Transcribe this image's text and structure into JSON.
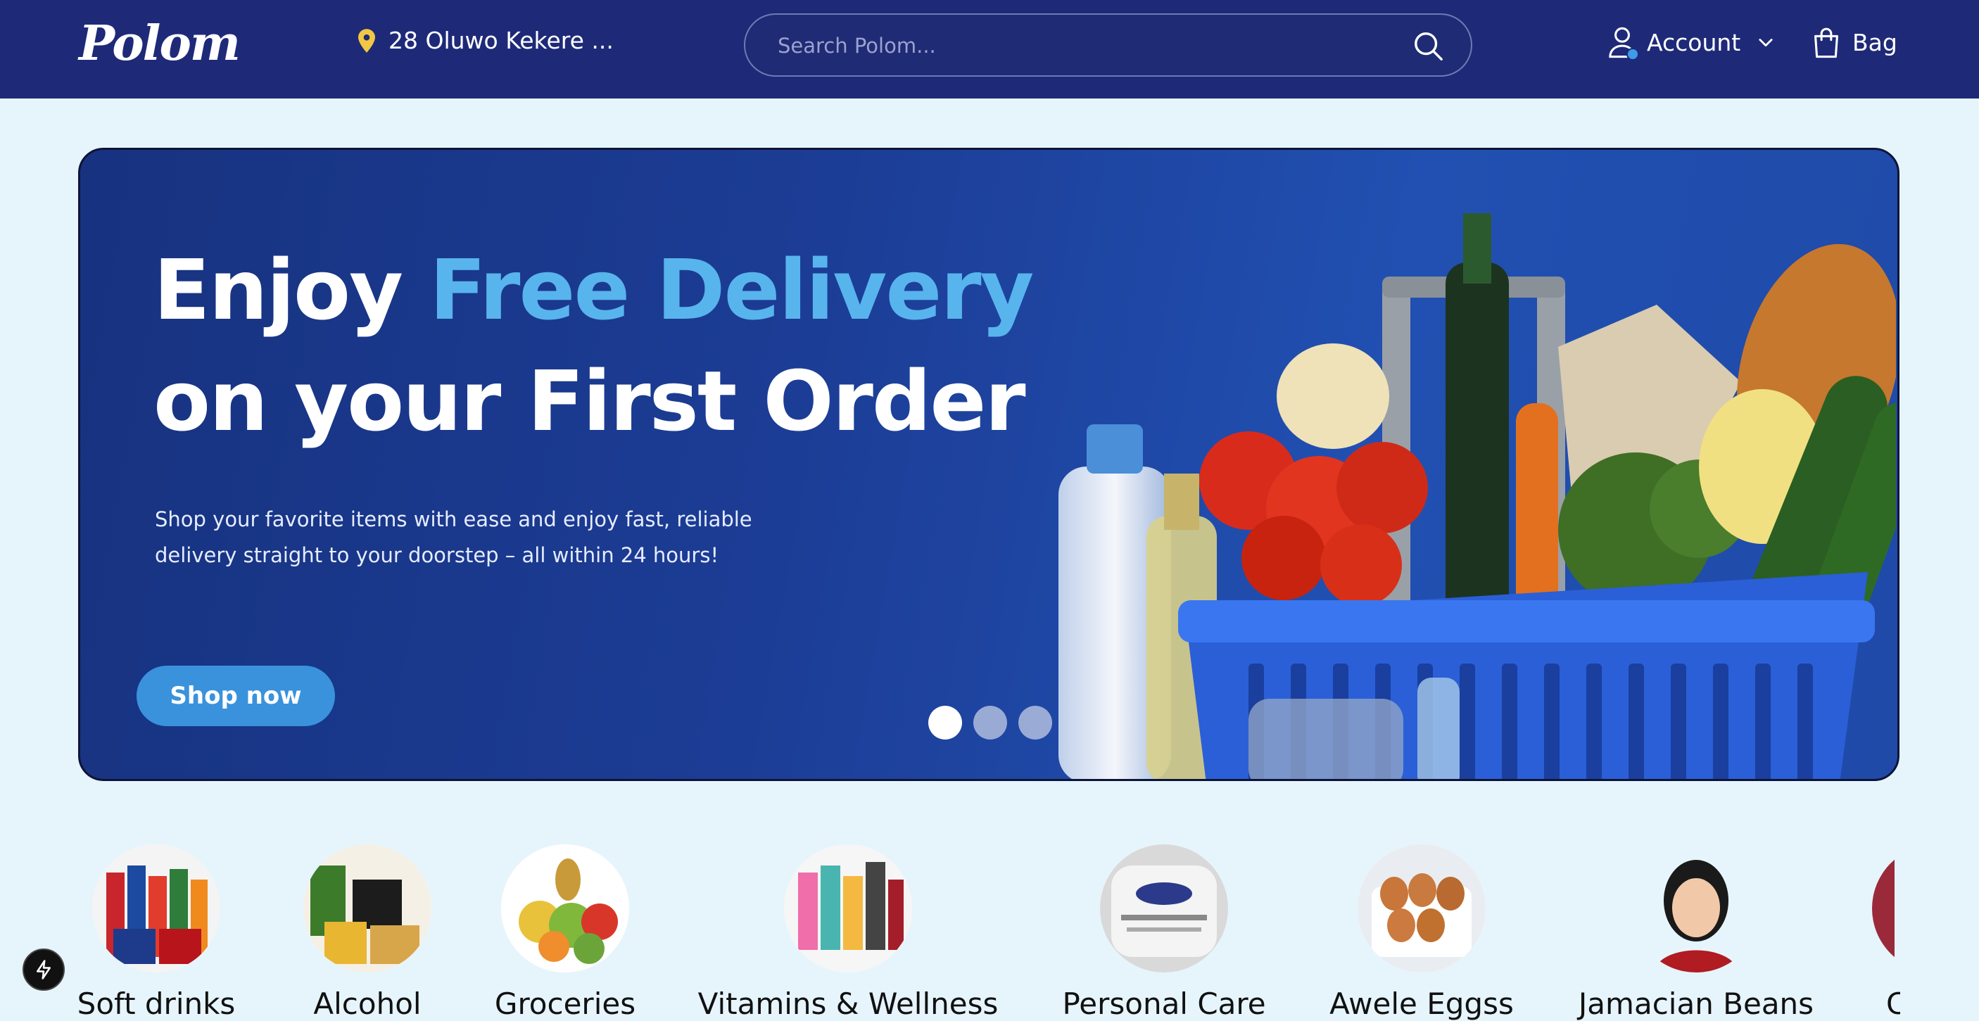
{
  "header": {
    "logo": "Polom",
    "location": "28 Oluwo Kekere ...",
    "search_placeholder": "Search Polom...",
    "account_label": "Account",
    "bag_label": "Bag"
  },
  "hero": {
    "title_part1": "Enjoy ",
    "title_accent": "Free Delivery",
    "title_line2": "on your First Order",
    "subtitle_line1": "Shop your favorite items with ease and enjoy fast, reliable",
    "subtitle_line2": "delivery straight to your doorstep – all within 24 hours!",
    "cta": "Shop now",
    "slides": 3,
    "active_slide": 1
  },
  "categories": [
    {
      "label": "Soft drinks"
    },
    {
      "label": "Alcohol"
    },
    {
      "label": "Groceries"
    },
    {
      "label": "Vitamins & Wellness"
    },
    {
      "label": "Personal Care"
    },
    {
      "label": "Awele Eggss"
    },
    {
      "label": "Jamacian Beans"
    },
    {
      "label": "C"
    }
  ],
  "colors": {
    "header_bg": "#1e2a78",
    "page_bg": "#e6f5fc",
    "accent": "#58b4ec",
    "button": "#3a92dc",
    "pin": "#f2c744"
  },
  "icons": [
    "location-pin-icon",
    "search-icon",
    "user-icon",
    "chevron-down-icon",
    "bag-icon",
    "bolt-icon"
  ]
}
